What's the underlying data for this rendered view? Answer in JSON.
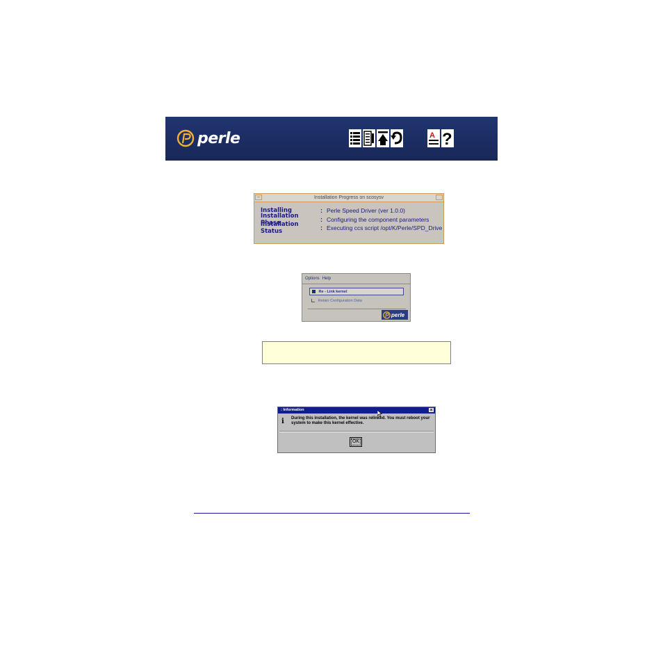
{
  "banner": {
    "logo_text": "perle",
    "nav_icons": [
      "contents-icon",
      "index-icon",
      "top-icon",
      "back-icon",
      "font-icon",
      "help-icon"
    ],
    "brand_color": "#1e3266"
  },
  "progress_window": {
    "title": "Installation Progress on scosysv",
    "rows": [
      {
        "label": "Installing",
        "sep": ":",
        "value": "Perle Speed Driver (ver 1.0.0)"
      },
      {
        "label": "Installation Phase",
        "sep": ":",
        "value": "Configuring the component parameters"
      },
      {
        "label": "Installation Status",
        "sep": ":",
        "value": "Executing ccs script /opt/K/Perle/SPD_Drive"
      }
    ]
  },
  "options_window": {
    "menu": [
      "Options",
      "Help"
    ],
    "items": [
      {
        "label": "Re - Link kernel",
        "selected": true
      },
      {
        "label": "Retain Configuration Data",
        "selected": false
      }
    ],
    "logo_text": "perle"
  },
  "info_dialog": {
    "title": ": Information",
    "close": "x",
    "icon": "i",
    "message": "During this installation, the kernel was relinked.  You must reboot your system to make this kernel effective.",
    "ok_label": "OK"
  }
}
